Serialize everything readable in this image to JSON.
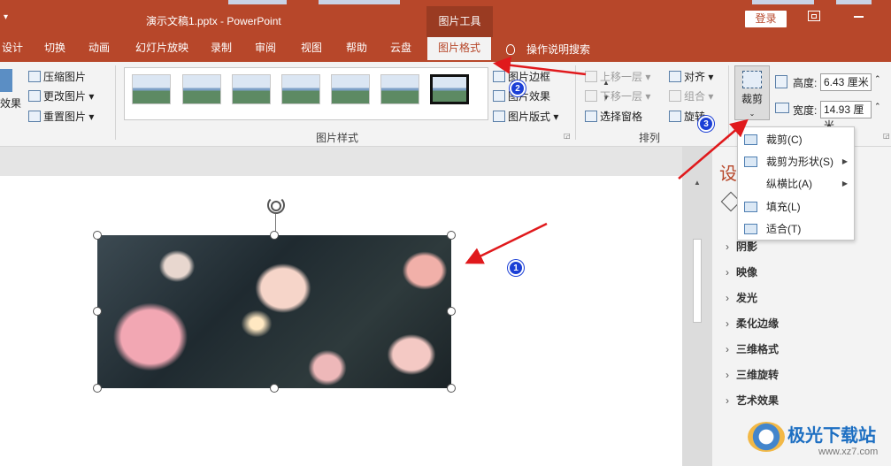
{
  "titlebar": {
    "quick_access": "▾",
    "doc_title": "演示文稿1.pptx  -  PowerPoint",
    "context_tab": "图片工具",
    "login": "登录",
    "bg_color": "#b7472a"
  },
  "tabs": [
    {
      "label": "设计"
    },
    {
      "label": "切换"
    },
    {
      "label": "动画"
    },
    {
      "label": "幻灯片放映"
    },
    {
      "label": "录制"
    },
    {
      "label": "审阅"
    },
    {
      "label": "视图"
    },
    {
      "label": "帮助"
    },
    {
      "label": "云盘"
    },
    {
      "label": "图片格式",
      "active": true
    }
  ],
  "search": {
    "label": "操作说明搜索"
  },
  "ribbon": {
    "adjust": {
      "effects": "效果",
      "compress": "压缩图片",
      "change": "更改图片",
      "reset": "重置图片"
    },
    "styles_group": "图片样式",
    "picture_border": "图片边框",
    "picture_effects": "图片效果",
    "picture_layout": "图片版式",
    "arrange": {
      "bring_forward": "上移一层",
      "send_backward": "下移一层",
      "selection_pane": "选择窗格",
      "align": "对齐",
      "group": "组合",
      "rotate": "旋转",
      "group_label": "排列"
    },
    "crop_label": "裁剪",
    "size": {
      "height_label": "高度:",
      "height_value": "6.43 厘米",
      "width_label": "宽度:",
      "width_value": "14.93 厘米"
    }
  },
  "crop_menu": [
    {
      "label": "裁剪(C)",
      "icon": "crop-icon",
      "sub": false
    },
    {
      "label": "裁剪为形状(S)",
      "icon": "shape-icon",
      "sub": true
    },
    {
      "label": "纵横比(A)",
      "icon": "",
      "sub": true
    },
    {
      "label": "填充(L)",
      "icon": "fill-icon",
      "sub": false
    },
    {
      "label": "适合(T)",
      "icon": "fit-icon",
      "sub": false
    }
  ],
  "format_pane": {
    "title": "设",
    "items": [
      "阴影",
      "映像",
      "发光",
      "柔化边缘",
      "三维格式",
      "三维旋转",
      "艺术效果"
    ]
  },
  "annotations": [
    {
      "number": "1"
    },
    {
      "number": "2"
    },
    {
      "number": "3"
    }
  ],
  "watermark": {
    "name": "极光下载站",
    "url": "www.xz7.com"
  }
}
